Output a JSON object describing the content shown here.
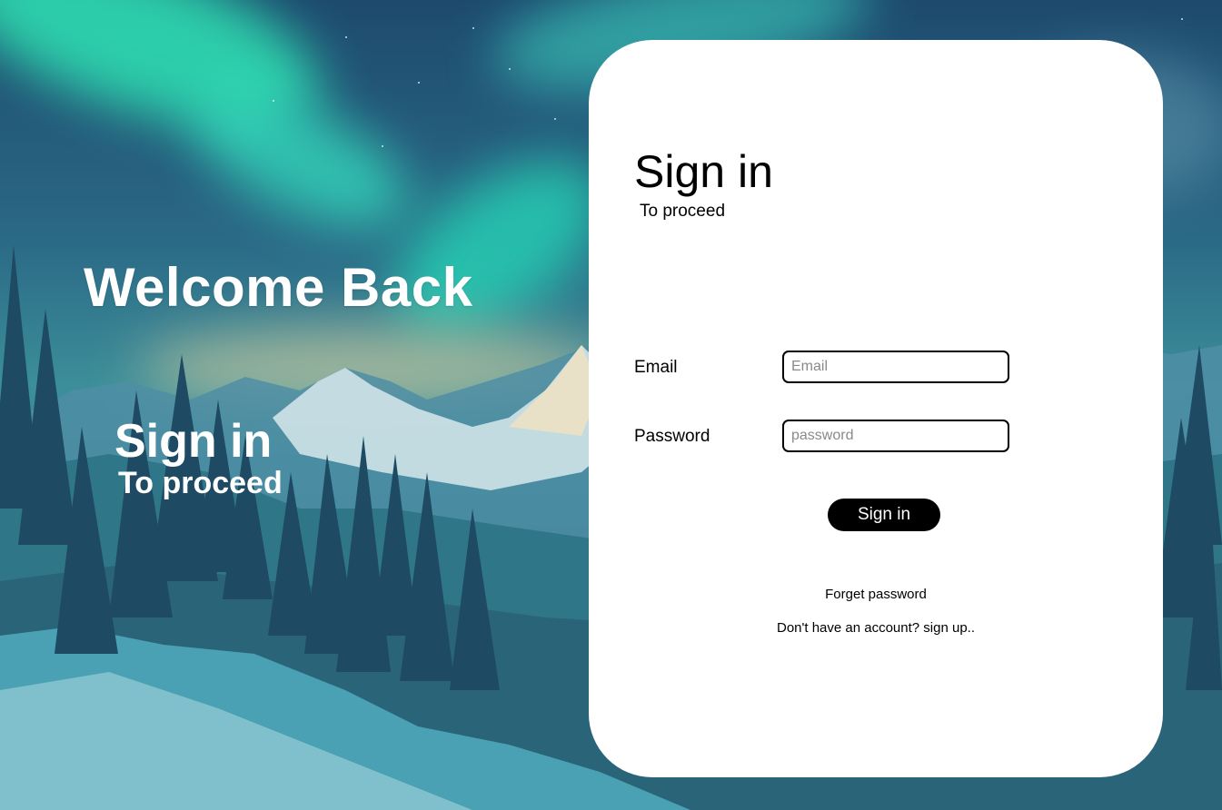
{
  "hero": {
    "title": "Welcome Back",
    "sub_big": "Sign in",
    "sub_small": "To proceed"
  },
  "card": {
    "title": "Sign in",
    "subtitle": "To proceed",
    "email": {
      "label": "Email",
      "placeholder": "Email",
      "value": ""
    },
    "password": {
      "label": "Password",
      "placeholder": "password",
      "value": ""
    },
    "submit_label": "Sign in",
    "forgot_label": "Forget password",
    "signup_label": "Don't have an account? sign up.."
  },
  "colors": {
    "card_bg": "#ffffff",
    "button_bg": "#000000",
    "button_text": "#ffffff",
    "aurora": "#2fe3b4"
  },
  "background": {
    "icon": "aurora-mountain-forest-landscape"
  }
}
